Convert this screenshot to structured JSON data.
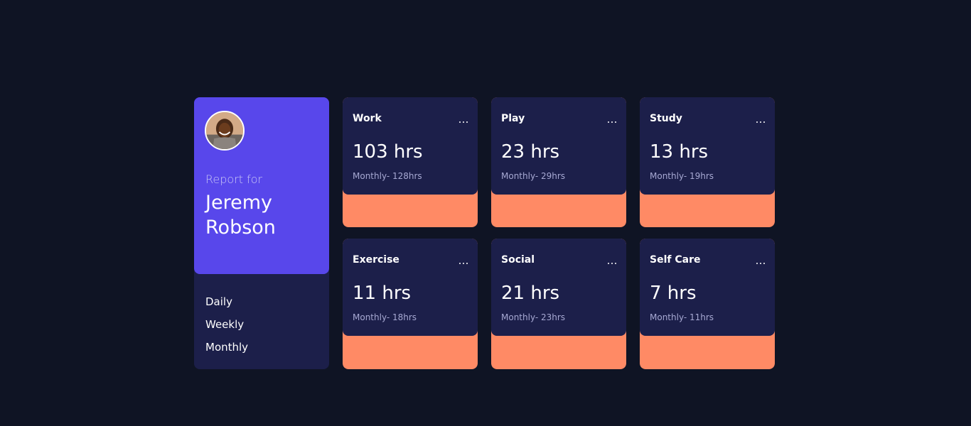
{
  "profile": {
    "report_label": "Report for",
    "name": "Jeremy Robson",
    "avatar_icon": "user-avatar",
    "accent_color": "#5847eb"
  },
  "timeframes": [
    "Daily",
    "Weekly",
    "Monthly"
  ],
  "cards": [
    {
      "title": "Work",
      "current": "103 hrs",
      "previous": "Monthly- 128hrs",
      "color": "#ff8a65",
      "menu_icon": "ellipsis-icon"
    },
    {
      "title": "Play",
      "current": "23 hrs",
      "previous": "Monthly- 29hrs",
      "color": "#ff8a65",
      "menu_icon": "ellipsis-icon"
    },
    {
      "title": "Study",
      "current": "13 hrs",
      "previous": "Monthly- 19hrs",
      "color": "#ff8a65",
      "menu_icon": "ellipsis-icon"
    },
    {
      "title": "Exercise",
      "current": "11 hrs",
      "previous": "Monthly- 18hrs",
      "color": "#ff8a65",
      "menu_icon": "ellipsis-icon"
    },
    {
      "title": "Social",
      "current": "21 hrs",
      "previous": "Monthly- 23hrs",
      "color": "#ff8a65",
      "menu_icon": "ellipsis-icon"
    },
    {
      "title": "Self Care",
      "current": "7 hrs",
      "previous": "Monthly- 11hrs",
      "color": "#ff8a65",
      "menu_icon": "ellipsis-icon"
    }
  ],
  "colors": {
    "background": "#0f1424",
    "card": "#1c1f4a",
    "secondary_text": "#a7a9d3"
  }
}
